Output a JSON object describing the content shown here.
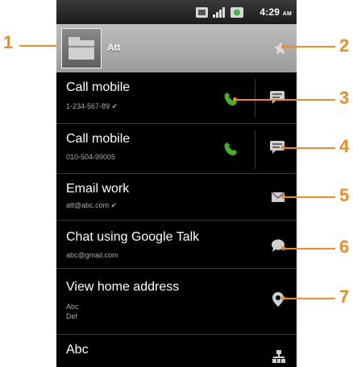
{
  "status_bar": {
    "time": "4:29",
    "ampm": "AM"
  },
  "contact": {
    "name": "Att"
  },
  "rows": [
    {
      "title": "Call mobile",
      "subtitle": "1-234-567-89 ✔"
    },
    {
      "title": "Call mobile",
      "subtitle": "010-504-99005"
    },
    {
      "title": "Email work",
      "subtitle": "att@abc.com ✔"
    },
    {
      "title": "Chat using Google Talk",
      "subtitle": "abc@gmail.com"
    },
    {
      "title": "View home address",
      "subtitle_lines": [
        "Abc",
        "Def"
      ]
    },
    {
      "title": "Abc"
    }
  ],
  "callouts": [
    "1",
    "2",
    "3",
    "4",
    "5",
    "6",
    "7"
  ],
  "colors": {
    "callout": "#f08c1f",
    "call_icon": "#47b023",
    "background": "#000000"
  },
  "icons": [
    "avatar-icon",
    "star-icon",
    "phone-icon",
    "message-icon",
    "email-icon",
    "chat-bubble-icon",
    "map-pin-icon",
    "org-chart-icon"
  ]
}
